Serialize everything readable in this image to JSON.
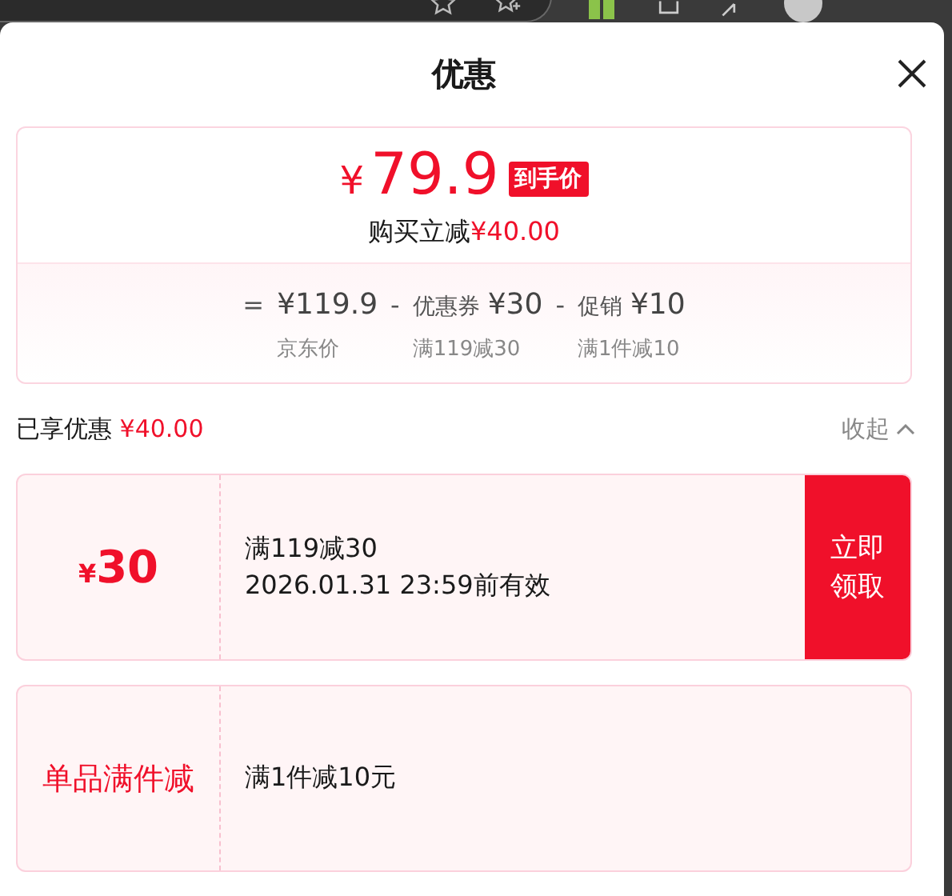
{
  "header": {
    "title": "优惠",
    "expanded": true
  },
  "summary": {
    "currency": "¥",
    "price": "79.9",
    "tag": "到手价",
    "saving_label": "购买立减",
    "saving": "¥40.00",
    "breakdown": [
      {
        "op": "=",
        "value": "¥119.9",
        "label": "京东价"
      },
      {
        "op": "-",
        "name": "优惠券",
        "value": "¥30",
        "label": "满119减30"
      },
      {
        "op": "-",
        "name": "促销",
        "value": "¥10",
        "label": "满1件减10"
      }
    ]
  },
  "enjoyed": {
    "label": "已享优惠",
    "amount": "¥40.00",
    "toggle": "收起",
    "expanded": true
  },
  "offers": [
    {
      "kind": "coupon",
      "currency": "¥",
      "amount": "30",
      "title": "满119减30",
      "validity": "2026.01.31 23:59前有效",
      "button": "立即领取"
    },
    {
      "kind": "promo",
      "tag": "单品满件减",
      "title": "满1件减10元"
    }
  ]
}
